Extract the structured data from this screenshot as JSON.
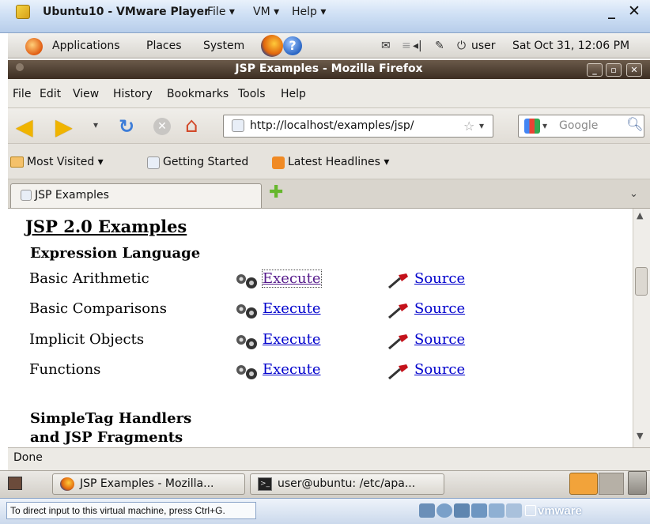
{
  "vmware": {
    "title": "Ubuntu10 - VMware Player",
    "menus": [
      "File",
      "VM",
      "Help"
    ],
    "status_message": "To direct input to this virtual machine, press Ctrl+G.",
    "logo_text": "vmware"
  },
  "gnome_panel": {
    "menus": [
      "Applications",
      "Places",
      "System"
    ],
    "user": "user",
    "datetime": "Sat Oct 31, 12:06 PM"
  },
  "firefox": {
    "window_title": "JSP Examples - Mozilla Firefox",
    "menu": [
      "File",
      "Edit",
      "View",
      "History",
      "Bookmarks",
      "Tools",
      "Help"
    ],
    "url": "http://localhost/examples/jsp/",
    "search_placeholder": "Google",
    "bookmarks": [
      "Most Visited",
      "Getting Started",
      "Latest Headlines"
    ],
    "tab_label": "JSP Examples",
    "status": "Done"
  },
  "page": {
    "title": "JSP 2.0 Examples",
    "section1": "Expression Language",
    "execute_label": "Execute",
    "source_label": "Source",
    "examples": [
      {
        "label": "Basic Arithmetic"
      },
      {
        "label": "Basic Comparisons"
      },
      {
        "label": "Implicit Objects"
      },
      {
        "label": "Functions"
      }
    ],
    "section2_line1": "SimpleTag Handlers",
    "section2_line2": "and JSP Fragments"
  },
  "taskbar": {
    "tasks": [
      "JSP Examples - Mozilla...",
      "user@ubuntu: /etc/apa..."
    ]
  },
  "colors": {
    "link": "#0000cc",
    "visited_link": "#551a8b",
    "firefox_titlebar": "#4a3b2e"
  }
}
